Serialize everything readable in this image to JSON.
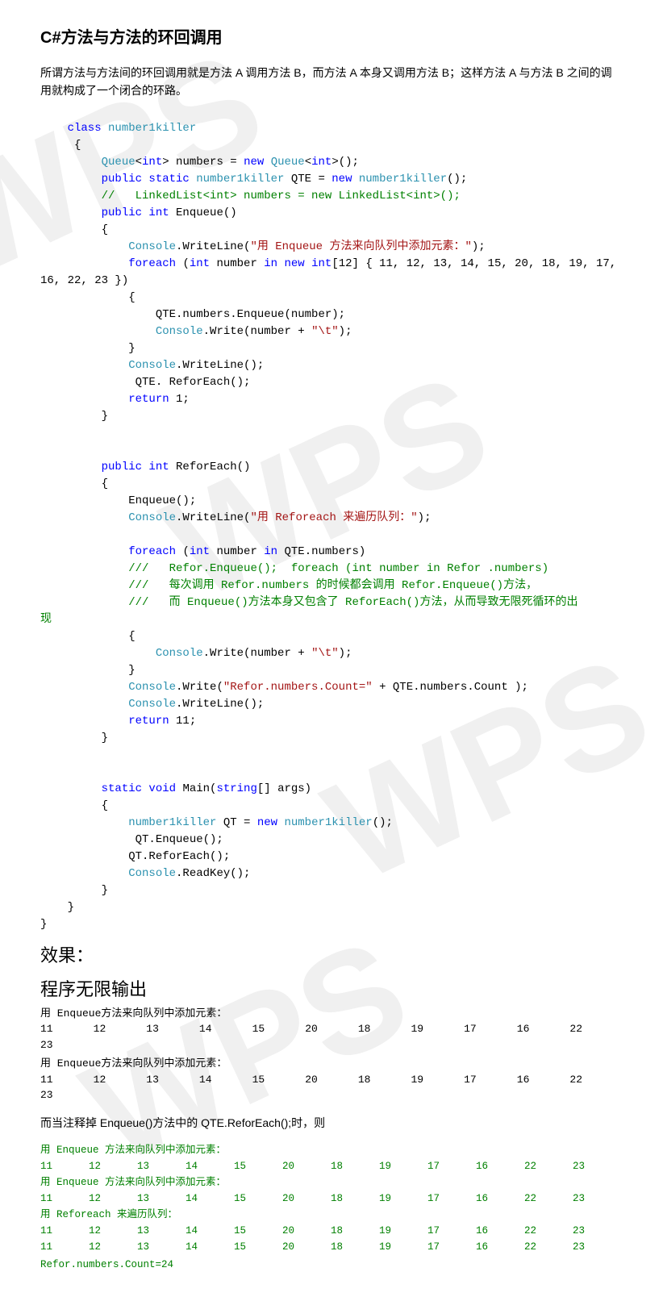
{
  "title": "C#方法与方法的环回调用",
  "intro": "所谓方法与方法间的环回调用就是方法 A 调用方法 B，而方法 A 本身又调用方法 B；这样方法 A 与方法 B 之间的调用就构成了一个闭合的环路。",
  "code": {
    "l1_a": "    class ",
    "l1_b": "number1killer",
    "l2": "     {",
    "l3_a": "         Queue",
    "l3_b": "<",
    "l3_c": "int",
    "l3_d": "> numbers = ",
    "l3_e": "new ",
    "l3_f": "Queue",
    "l3_g": "<",
    "l3_h": "int",
    "l3_i": ">();",
    "l4_a": "         public static ",
    "l4_b": "number1killer",
    "l4_c": " QTE = ",
    "l4_d": "new ",
    "l4_e": "number1killer",
    "l4_f": "();",
    "l5": "         //   LinkedList<int> numbers = new LinkedList<int>();",
    "l6_a": "         public int ",
    "l6_b": "Enqueue()",
    "l7": "         {",
    "l8_a": "             Console",
    "l8_b": ".WriteLine(",
    "l8_c": "\"用 Enqueue 方法来向队列中添加元素：\"",
    "l8_d": ");",
    "l9_a": "             foreach ",
    "l9_b": "(",
    "l9_c": "int ",
    "l9_d": "number ",
    "l9_e": "in ",
    "l9_f": "new ",
    "l9_g": "int",
    "l9_h": "[12] { 11, 12, 13, 14, 15, 20, 18, 19, 17,",
    "l10": "16, 22, 23 })",
    "l11": "             {",
    "l12": "                 QTE.numbers.Enqueue(number);",
    "l13_a": "                 Console",
    "l13_b": ".Write(number + ",
    "l13_c": "\"\\t\"",
    "l13_d": ");",
    "l14": "             }",
    "l15_a": "             Console",
    "l15_b": ".WriteLine();",
    "l16": "              QTE. ReforEach();",
    "l17_a": "             return ",
    "l17_b": "1;",
    "l18": "         }",
    "l19": "",
    "l20": "",
    "l21_a": "         public int ",
    "l21_b": "ReforEach()",
    "l22": "         {",
    "l23": "             Enqueue();",
    "l24_a": "             Console",
    "l24_b": ".WriteLine(",
    "l24_c": "\"用 Reforeach 来遍历队列：\"",
    "l24_d": ");",
    "l25": "",
    "l26_a": "             foreach ",
    "l26_b": "(",
    "l26_c": "int ",
    "l26_d": "number ",
    "l26_e": "in ",
    "l26_f": "QTE.numbers)",
    "l27": "             ///   Refor.Enqueue();  foreach (int number in Refor .numbers)",
    "l28": "             ///   每次调用 Refor.numbers 的时候都会调用 Refor.Enqueue()方法，",
    "l29": "             ///   而 Enqueue()方法本身又包含了 ReforEach()方法，从而导致无限死循环的出",
    "l29b": "现",
    "l30": "             {",
    "l31_a": "                 Console",
    "l31_b": ".Write(number + ",
    "l31_c": "\"\\t\"",
    "l31_d": ");",
    "l32": "             }",
    "l33_a": "             Console",
    "l33_b": ".Write(",
    "l33_c": "\"Refor.numbers.Count=\"",
    "l33_d": " + QTE.numbers.Count );",
    "l34_a": "             Console",
    "l34_b": ".WriteLine();",
    "l35_a": "             return ",
    "l35_b": "11;",
    "l36": "         }",
    "l37": "",
    "l38": "",
    "l39_a": "         static void ",
    "l39_b": "Main(",
    "l39_c": "string",
    "l39_d": "[] args)",
    "l40": "         {",
    "l41_a": "             number1killer",
    "l41_b": " QT = ",
    "l41_c": "new ",
    "l41_d": "number1killer",
    "l41_e": "();",
    "l42": "              QT.Enqueue();",
    "l43": "             QT.ReforEach();",
    "l44_a": "             Console",
    "l44_b": ".ReadKey();",
    "l45": "         }",
    "l46": "    }",
    "l47": "}"
  },
  "result_h": "效果：",
  "result_sub": "程序无限输出",
  "out1_label": "用 Enqueue方法来向队列中添加元素：",
  "out_row": [
    "11",
    "12",
    "13",
    "14",
    "15",
    "20",
    "18",
    "19",
    "17",
    "16",
    "22"
  ],
  "out_row_tail": "23",
  "note2": "而当注释掉 Enqueue()方法中的  QTE.ReforEach();时，则",
  "green": {
    "enq_label": "用 Enqueue 方法来向队列中添加元素：",
    "row": [
      "11",
      "12",
      "13",
      "14",
      "15",
      "20",
      "18",
      "19",
      "17",
      "16",
      "22",
      "23"
    ],
    "ref_label": "用 Reforeach 来遍历队列：",
    "count": "Refor.numbers.Count=24"
  }
}
